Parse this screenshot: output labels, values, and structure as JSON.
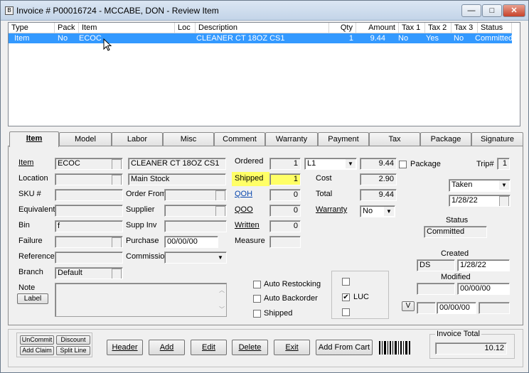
{
  "window": {
    "icon_text": "B",
    "title": "Invoice # P00016724  -  MCCABE, DON      - Review Item",
    "min": "—",
    "max": "□",
    "close": "✕"
  },
  "grid": {
    "headers": [
      "Type",
      "Pack",
      "Item",
      "Loc",
      "Description",
      "Qty",
      "Amount",
      "Tax 1",
      "Tax 2",
      "Tax 3",
      "Status"
    ],
    "rows": [
      {
        "type": "Item",
        "pack": "No",
        "item": "ECOC",
        "loc": "",
        "desc": "CLEANER CT 18OZ CS1",
        "qty": "1",
        "amount": "9.44",
        "tax1": "No",
        "tax2": "Yes",
        "tax3": "No",
        "status": "Committed"
      }
    ]
  },
  "tabs": [
    "Item",
    "Model",
    "Labor",
    "Misc",
    "Comment",
    "Warranty",
    "Payment",
    "Tax",
    "Package",
    "Signature"
  ],
  "form": {
    "item_label": "Item",
    "item_value": "ECOC",
    "item_desc": "CLEANER CT 18OZ CS1",
    "location_label": "Location",
    "location_value": "Main Stock",
    "sku_label": "SKU #",
    "order_from_label": "Order From",
    "equivalent_label": "Equivalent",
    "supplier_label": "Supplier",
    "bin_label": "Bin",
    "bin_value": "f",
    "supp_inv_label": "Supp Inv",
    "failure_label": "Failure",
    "purchase_label": "Purchase",
    "purchase_value": "00/00/00",
    "reference_label": "Reference",
    "commission_label": "Commission",
    "branch_label": "Branch",
    "branch_value": "Default",
    "note_label": "Note",
    "note_btn": "Label",
    "ordered_label": "Ordered",
    "ordered_value": "1",
    "level_value": "L1",
    "ordered_price": "9.44",
    "shipped_label": "Shipped",
    "shipped_value": "1",
    "cost_label": "Cost",
    "cost_value": "2.90",
    "qoh_label": "QOH",
    "qoh_value": "0",
    "total_label": "Total",
    "total_value": "9.44",
    "qoo_label": "QOO",
    "qoo_value": "0",
    "warranty_label": "Warranty",
    "warranty_value": "No",
    "written_label": "Written",
    "written_value": "0",
    "measure_label": "Measure",
    "package_label": "Package",
    "trip_label": "Trip#",
    "trip_value": "1",
    "taken_value": "Taken",
    "taken_date": "1/28/22",
    "status_label": "Status",
    "status_value": "Committed",
    "created_label": "Created",
    "created_by": "DS",
    "created_date": "1/28/22",
    "modified_label": "Modified",
    "modified_date": "00/00/00",
    "v_btn": "V",
    "v_date": "00/00/00",
    "auto_restocking": "Auto Restocking",
    "auto_backorder": "Auto Backorder",
    "shipped_chk": "Shipped",
    "luc_label": "LUC",
    "luc_check": "✔"
  },
  "bottom": {
    "uncommit": "UnCommit",
    "discount": "Discount",
    "add_claim": "Add Claim",
    "split_line": "Split Line",
    "header": "Header",
    "add": "Add",
    "edit": "Edit",
    "delete": "Delete",
    "exit": "Exit",
    "add_from_cart": "Add From Cart",
    "invoice_total_label": "Invoice Total",
    "invoice_total_value": "10.12"
  },
  "colors": {
    "selection": "#3399ff",
    "highlight": "#ffff66"
  }
}
